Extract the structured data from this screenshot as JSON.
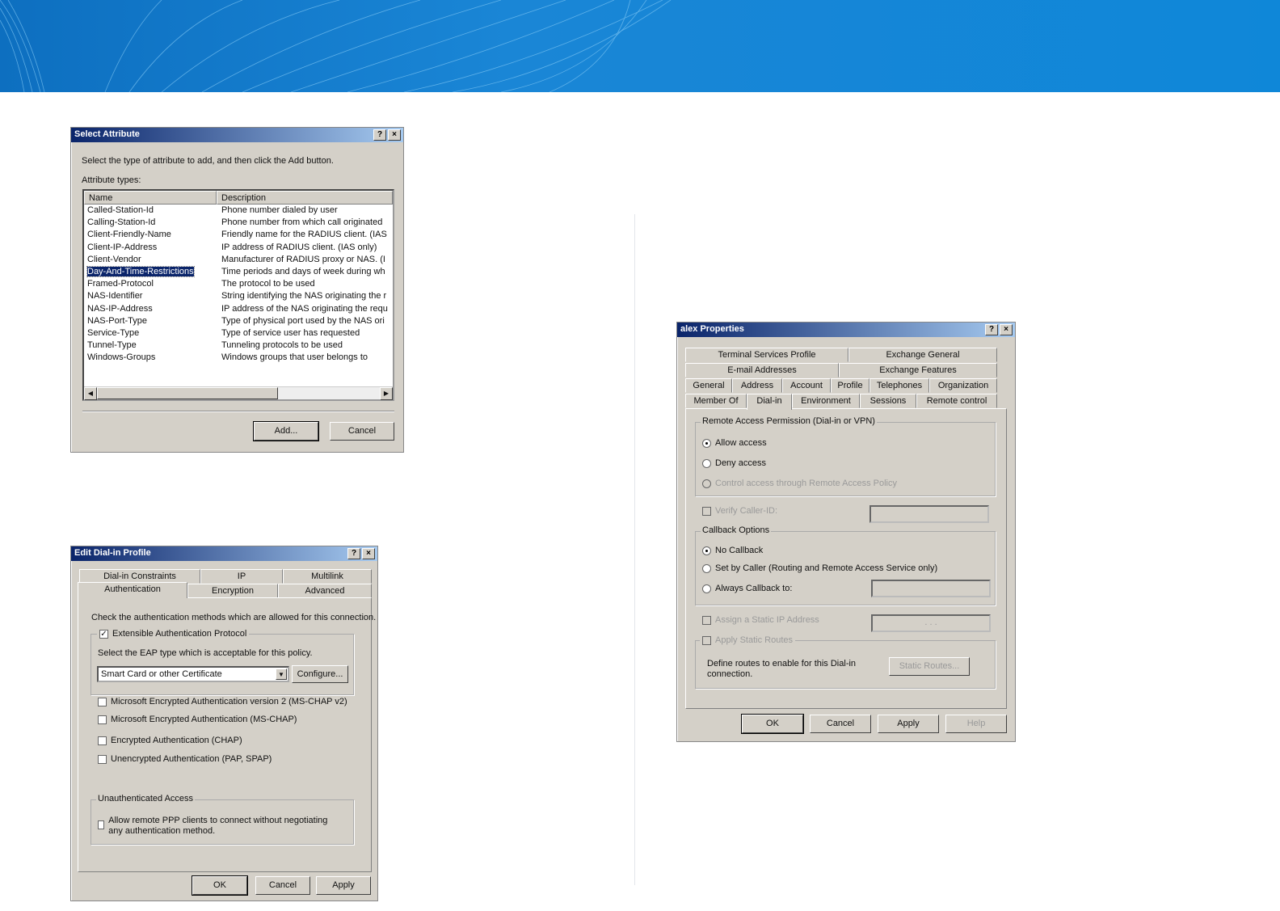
{
  "select_attribute": {
    "title": "Select Attribute",
    "help": "?",
    "close": "×",
    "instruction": "Select the type of attribute to add, and then click the Add button.",
    "list_label": "Attribute types:",
    "columns": [
      "Name",
      "Description"
    ],
    "rows": [
      {
        "name": "Called-Station-Id",
        "desc": "Phone number dialed by user"
      },
      {
        "name": "Calling-Station-Id",
        "desc": "Phone number from which call originated"
      },
      {
        "name": "Client-Friendly-Name",
        "desc": "Friendly name for the RADIUS client. (IAS"
      },
      {
        "name": "Client-IP-Address",
        "desc": "IP address of RADIUS client. (IAS only)"
      },
      {
        "name": "Client-Vendor",
        "desc": "Manufacturer of RADIUS proxy or NAS. (I"
      },
      {
        "name": "Day-And-Time-Restrictions",
        "desc": "Time periods and days of week during wh"
      },
      {
        "name": "Framed-Protocol",
        "desc": "The protocol to be used"
      },
      {
        "name": "NAS-Identifier",
        "desc": "String identifying the NAS originating the r"
      },
      {
        "name": "NAS-IP-Address",
        "desc": "IP address of the NAS originating the requ"
      },
      {
        "name": "NAS-Port-Type",
        "desc": "Type of physical port used by the NAS ori"
      },
      {
        "name": "Service-Type",
        "desc": "Type of service user has requested"
      },
      {
        "name": "Tunnel-Type",
        "desc": "Tunneling protocols to be used"
      },
      {
        "name": "Windows-Groups",
        "desc": "Windows groups that user belongs to"
      }
    ],
    "selected_index": 5,
    "add": "Add...",
    "cancel": "Cancel"
  },
  "edit_profile": {
    "title": "Edit Dial-in Profile",
    "help": "?",
    "close": "×",
    "tabs_back": [
      "Dial-in Constraints",
      "IP",
      "Multilink"
    ],
    "tabs_front": [
      "Authentication",
      "Encryption",
      "Advanced"
    ],
    "instruction": "Check the authentication methods which are allowed for this connection.",
    "eap_label": "Extensible Authentication Protocol",
    "eap_checked": true,
    "eap_select_label": "Select the EAP type which is acceptable for this policy.",
    "eap_type": "Smart Card or other Certificate",
    "configure": "Configure...",
    "methods": [
      "Microsoft Encrypted Authentication version 2 (MS-CHAP v2)",
      "Microsoft Encrypted Authentication (MS-CHAP)",
      "Encrypted Authentication (CHAP)",
      "Unencrypted Authentication (PAP, SPAP)"
    ],
    "unauth_group": "Unauthenticated Access",
    "unauth_option": "Allow remote PPP clients to connect without negotiating any authentication method.",
    "ok": "OK",
    "cancel": "Cancel",
    "apply": "Apply"
  },
  "alex": {
    "title": "alex Properties",
    "help": "?",
    "close": "×",
    "tabs_row1": [
      "Terminal Services Profile",
      "Exchange General"
    ],
    "tabs_row2": [
      "E-mail Addresses",
      "Exchange Features"
    ],
    "tabs_row3": [
      "General",
      "Address",
      "Account",
      "Profile",
      "Telephones",
      "Organization"
    ],
    "tabs_row4": [
      "Member Of",
      "Dial-in",
      "Environment",
      "Sessions",
      "Remote control"
    ],
    "permission_group": "Remote Access Permission (Dial-in or VPN)",
    "perm_allow": "Allow access",
    "perm_deny": "Deny access",
    "perm_policy": "Control access through Remote Access Policy",
    "verify_caller": "Verify Caller-ID:",
    "callback_group": "Callback Options",
    "cb_none": "No Callback",
    "cb_caller": "Set by Caller (Routing and Remote Access Service only)",
    "cb_always": "Always Callback to:",
    "static_ip": "Assign a Static IP Address",
    "ip_dots": ".   .   .",
    "static_routes": "Apply Static Routes",
    "routes_desc": "Define routes to enable for this Dial-in connection.",
    "static_routes_btn": "Static Routes...",
    "ok": "OK",
    "cancel": "Cancel",
    "apply": "Apply",
    "help_btn": "Help"
  }
}
